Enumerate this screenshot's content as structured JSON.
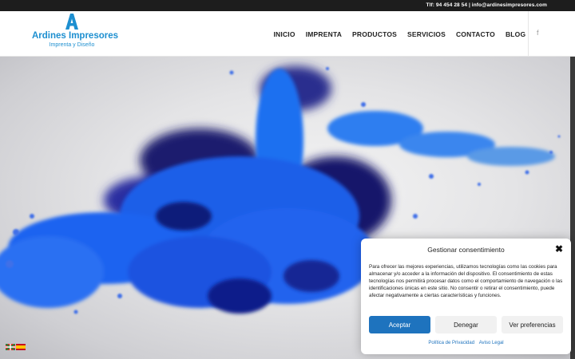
{
  "topbar": {
    "contact": "Tlf: 94 454 28 54 | info@ardinesimpresores.com"
  },
  "logo": {
    "letter": "A",
    "name": "Ardines Impresores",
    "tagline": "Imprenta y Diseño"
  },
  "nav": {
    "items": [
      "INICIO",
      "IMPRENTA",
      "PRODUCTOS",
      "SERVICIOS",
      "CONTACTO",
      "BLOG"
    ]
  },
  "social": {
    "facebook": "f"
  },
  "colors": {
    "brand": "#1d8fd0",
    "accent": "#1e73be",
    "topbar": "#1d1d1d"
  },
  "cookie": {
    "title": "Gestionar consentimiento",
    "close": "✖",
    "text": "Para ofrecer las mejores experiencias, utilizamos tecnologías como las cookies para almacenar y/o acceder a la información del dispositivo. El consentimiento de estas tecnologías nos permitirá procesar datos como el comportamiento de navegación o las identificaciones únicas en este sitio. No consentir o retirar el consentimiento, puede afectar negativamente a ciertas características y funciones.",
    "accept": "Aceptar",
    "deny": "Denegar",
    "preferences": "Ver preferencias",
    "privacy_link": "Política de Privacidad",
    "legal_link": "Aviso Legal"
  },
  "languages": [
    "eu-flag-icon",
    "es-flag-icon"
  ]
}
